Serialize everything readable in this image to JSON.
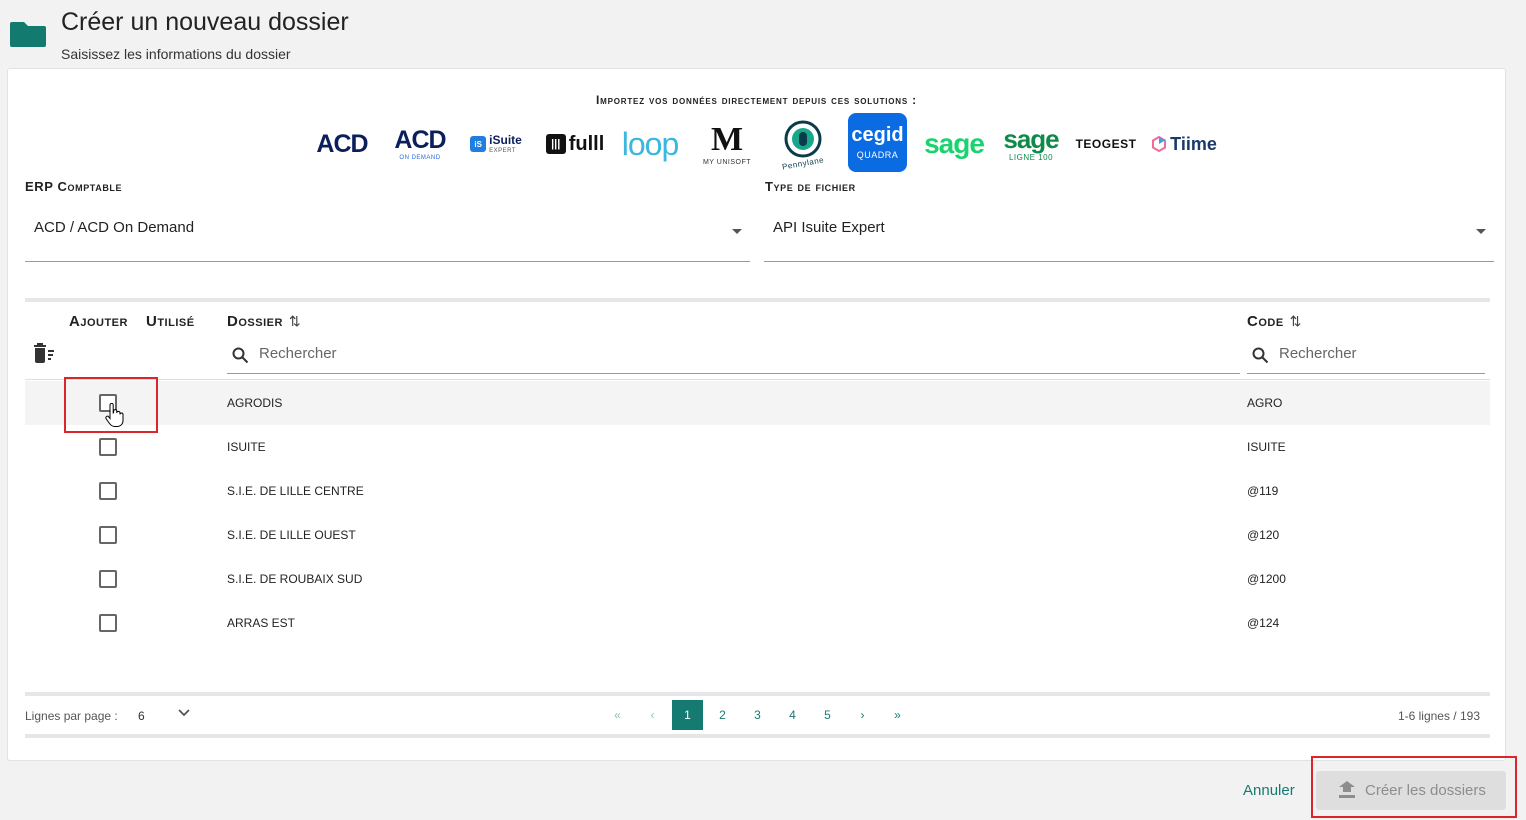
{
  "header": {
    "title": "Créer un nouveau dossier",
    "subtitle": "Saisissez les informations du dossier",
    "folder_color": "#127a6e"
  },
  "import": {
    "title": "Importez vos données directement depuis ces solutions :",
    "logos": [
      {
        "name": "ACD",
        "sub": ""
      },
      {
        "name": "ACD",
        "sub": "ON DEMAND"
      },
      {
        "name": "iSuite",
        "sub": "EXPERT"
      },
      {
        "name": "fulll",
        "sub": ""
      },
      {
        "name": "loop",
        "sub": ""
      },
      {
        "name": "M",
        "sub": "MY UNISOFT"
      },
      {
        "name": "",
        "sub": "Pennylane"
      },
      {
        "name": "cegid",
        "sub": "QUADRA"
      },
      {
        "name": "sage",
        "sub": ""
      },
      {
        "name": "sage",
        "sub": "LIGNE 100"
      },
      {
        "name": "TEOGEST",
        "sub": ""
      },
      {
        "name": "Tiime",
        "sub": ""
      }
    ]
  },
  "erp": {
    "label": "ERP Comptable",
    "value": "ACD / ACD On Demand"
  },
  "file_type": {
    "label": "Type de fichier",
    "value": "API Isuite Expert"
  },
  "table": {
    "headers": {
      "add": "Ajouter",
      "used": "Utilisé",
      "dossier": "Dossier",
      "code": "Code"
    },
    "sort_symbol": "⇅",
    "search_placeholder": "Rechercher",
    "rows": [
      {
        "name": "AGRODIS",
        "code": "AGRO",
        "checked": false
      },
      {
        "name": "ISUITE",
        "code": "ISUITE",
        "checked": false
      },
      {
        "name": "S.I.E. DE LILLE CENTRE",
        "code": "@119",
        "checked": false
      },
      {
        "name": "S.I.E. DE LILLE OUEST",
        "code": "@120",
        "checked": false
      },
      {
        "name": "S.I.E. DE ROUBAIX SUD",
        "code": "@1200",
        "checked": false
      },
      {
        "name": "ARRAS EST",
        "code": "@124",
        "checked": false
      }
    ]
  },
  "pagination": {
    "rows_per_page_label": "Lignes par page :",
    "rows_per_page": "6",
    "first": "«",
    "prev": "‹",
    "pages": [
      "1",
      "2",
      "3",
      "4",
      "5"
    ],
    "current_page": "1",
    "next": "›",
    "last": "»",
    "range": "1-6 lignes / 193"
  },
  "actions": {
    "cancel": "Annuler",
    "create": "Créer les dossiers"
  },
  "colors": {
    "accent": "#167a72",
    "highlight": "#d9262c",
    "disabled_bg": "#dedede",
    "disabled_text": "#8d8d8d"
  }
}
